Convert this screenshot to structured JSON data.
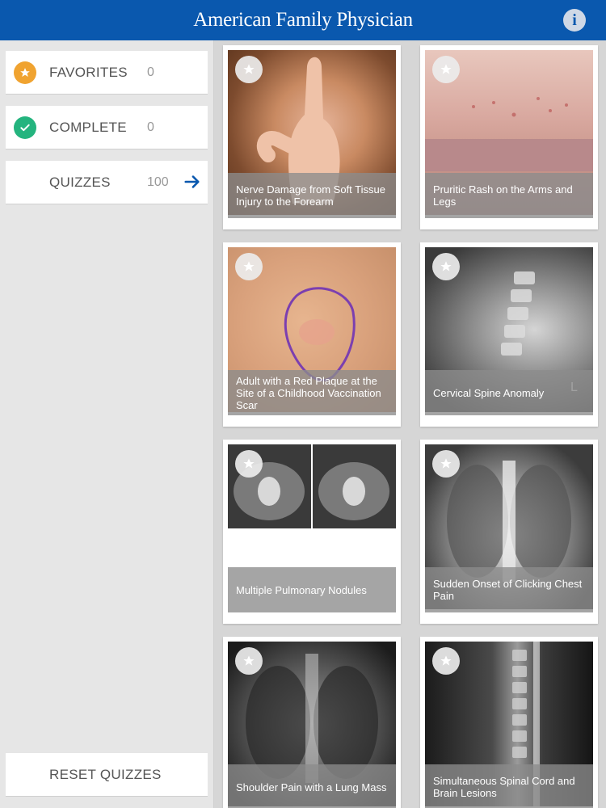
{
  "header": {
    "title": "American Family Physician"
  },
  "sidebar": {
    "items": [
      {
        "label": "FAVORITES",
        "count": "0"
      },
      {
        "label": "COMPLETE",
        "count": "0"
      },
      {
        "label": "QUIZZES",
        "count": "100"
      }
    ],
    "reset_label": "RESET QUIZZES"
  },
  "cards": [
    {
      "caption": "Nerve Damage from Soft Tissue Injury to the Forearm"
    },
    {
      "caption": "Pruritic Rash on the Arms and Legs"
    },
    {
      "caption": "Adult with a Red Plaque at the Site of a Childhood Vaccination Scar"
    },
    {
      "caption": "Cervical Spine Anomaly"
    },
    {
      "caption": "Multiple Pulmonary Nodules"
    },
    {
      "caption": "Sudden Onset of Clicking Chest Pain"
    },
    {
      "caption": "Shoulder Pain with a Lung Mass"
    },
    {
      "caption": "Simultaneous Spinal Cord and Brain Lesions"
    }
  ],
  "colors": {
    "header_bg": "#0a58ae",
    "favorites_icon": "#f0a330",
    "complete_icon": "#24b47e",
    "arrow": "#0a58ae"
  },
  "icons": {
    "info": "info-icon",
    "favorites": "star-icon",
    "complete": "checkmark-icon",
    "quizzes_arrow": "arrow-right-icon",
    "card_star": "star-icon"
  }
}
